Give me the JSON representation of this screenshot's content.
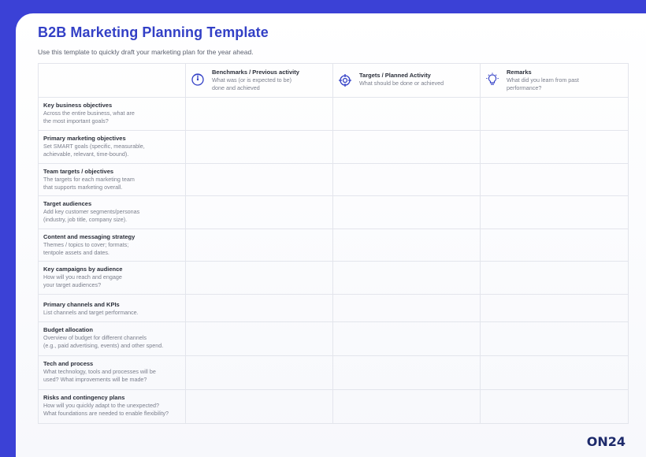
{
  "title": "B2B Marketing Planning Template",
  "subtitle": "Use this template to quickly draft your marketing plan for the year ahead.",
  "columns": [
    {
      "icon": "benchmark-dial-icon",
      "title": "Benchmarks / Previous activity",
      "desc": "What was (or is expected to be)\ndone and achieved"
    },
    {
      "icon": "target-crosshair-icon",
      "title": "Targets / Planned Activity",
      "desc": "What should be done or achieved"
    },
    {
      "icon": "lightbulb-icon",
      "title": "Remarks",
      "desc": "What did you learn from past\nperformance?"
    }
  ],
  "rows": [
    {
      "title": "Key business objectives",
      "desc": "Across the entire business, what are\nthe most important goals?"
    },
    {
      "title": "Primary marketing objectives",
      "desc": "Set SMART goals (specific, measurable,\nachievable, relevant, time-bound)."
    },
    {
      "title": "Team targets / objectives",
      "desc": "The targets for each marketing team\nthat supports marketing overall."
    },
    {
      "title": "Target audiences",
      "desc": "Add key customer segments/personas\n(industry, job title, company size)."
    },
    {
      "title": "Content and messaging strategy",
      "desc": "Themes / topics to cover; formats;\ntentpole assets and dates."
    },
    {
      "title": "Key campaigns by audience",
      "desc": "How will you reach and engage\nyour target audiences?"
    },
    {
      "title": "Primary channels and KPIs",
      "desc": "List channels and target performance."
    },
    {
      "title": "Budget allocation",
      "desc": "Overview of budget for different channels\n(e.g., paid advertising, events) and other spend."
    },
    {
      "title": "Tech and process",
      "desc": "What technology, tools and processes will be\nused? What improvements will be made?"
    },
    {
      "title": "Risks and contingency plans",
      "desc": "How will you quickly adapt to the unexpected?\nWhat foundations are needed to enable flexibility?"
    }
  ],
  "logo": {
    "text": "ON24"
  },
  "colors": {
    "accent": "#3340c6",
    "brand_bg": "#3b41d6",
    "logo": "#1d2a6b"
  }
}
